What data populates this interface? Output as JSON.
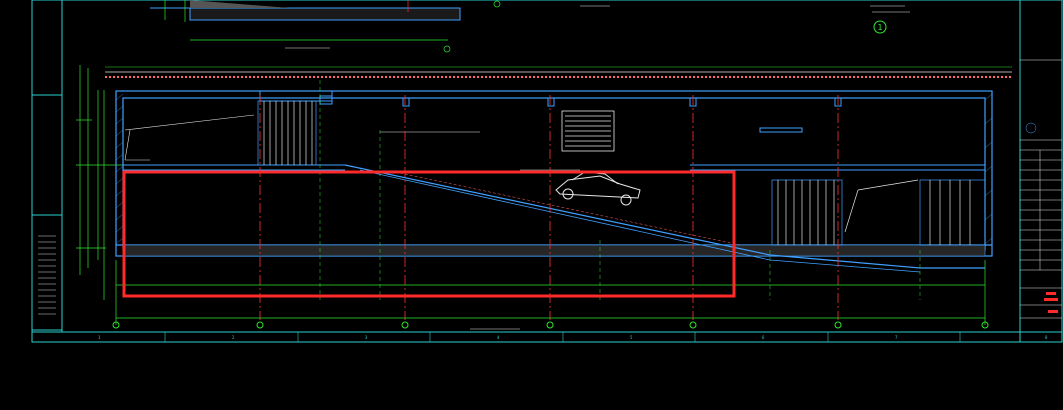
{
  "drawing": {
    "circle_marker": "1",
    "axis_letters": [
      "A",
      "1",
      "2",
      "3",
      "4",
      "5",
      "6"
    ],
    "frame_numbers": [
      "1",
      "2",
      "3",
      "4",
      "5",
      "6",
      "7",
      "8"
    ],
    "title_block_rows": [
      "",
      "",
      "",
      "",
      "",
      "",
      "",
      "",
      ""
    ],
    "highlight_color": "#ff2a2a",
    "line_colors": {
      "structure": "#3fa0ff",
      "dimension": "#2ee62e",
      "axis": "#ff3030",
      "frame": "#2ad0d0",
      "text": "#e6e6e6",
      "hatch": "#ff6a6a"
    }
  }
}
